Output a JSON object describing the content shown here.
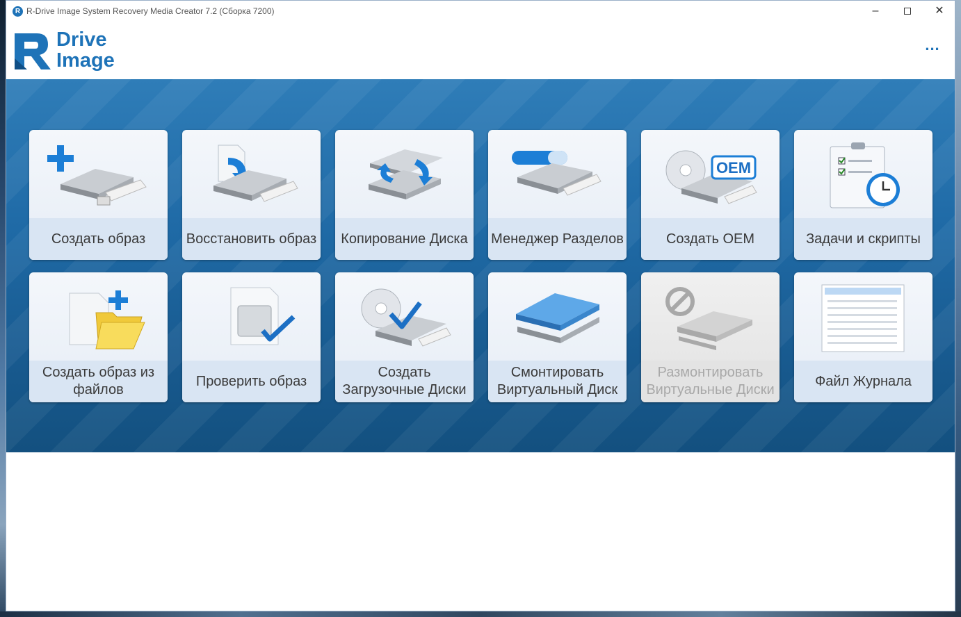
{
  "window": {
    "title": "R-Drive Image System Recovery Media Creator 7.2 (Сборка 7200)",
    "controls": {
      "minimize": "–",
      "close": "✕"
    }
  },
  "logo": {
    "line1": "Drive",
    "line2": "Image",
    "brand_color": "#1e73b8"
  },
  "header": {
    "more_label": "..."
  },
  "colors": {
    "panel_top": "#2f7db8",
    "panel_bottom": "#13507f",
    "tile_label_bg": "#d9e5f3"
  },
  "tiles": [
    {
      "label": "Создать образ",
      "icon": "create-image-icon",
      "enabled": true
    },
    {
      "label": "Восстановить образ",
      "icon": "restore-image-icon",
      "enabled": true
    },
    {
      "label": "Копирование Диска",
      "icon": "disk-copy-icon",
      "enabled": true
    },
    {
      "label": "Менеджер Разделов",
      "icon": "partition-manager-icon",
      "enabled": true
    },
    {
      "label": "Создать OEM",
      "icon": "create-oem-icon",
      "enabled": true,
      "badge": "OEM"
    },
    {
      "label": "Задачи и скрипты",
      "icon": "tasks-scripts-icon",
      "enabled": true
    },
    {
      "label": "Создать образ из файлов",
      "icon": "create-image-from-files-icon",
      "enabled": true
    },
    {
      "label": "Проверить образ",
      "icon": "check-image-icon",
      "enabled": true
    },
    {
      "label": "Создать Загрузочные Диски",
      "icon": "create-boot-disks-icon",
      "enabled": true
    },
    {
      "label": "Смонтировать Виртуальный Диск",
      "icon": "mount-virtual-disk-icon",
      "enabled": true
    },
    {
      "label": "Размонтировать Виртуальные Диски",
      "icon": "unmount-virtual-disks-icon",
      "enabled": false
    },
    {
      "label": "Файл Журнала",
      "icon": "log-file-icon",
      "enabled": true
    }
  ]
}
